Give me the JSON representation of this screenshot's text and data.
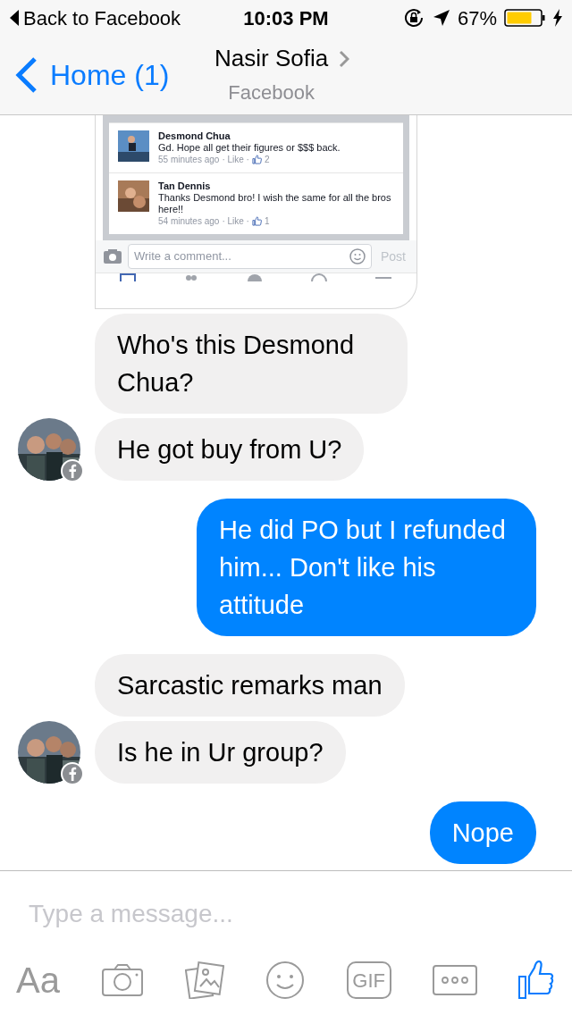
{
  "status_bar": {
    "back_label": "Back to Facebook",
    "time": "10:03 PM",
    "battery": "67%"
  },
  "nav": {
    "back": "Home (1)",
    "title": "Nasir Sofia",
    "subtitle": "Facebook"
  },
  "shared_image": {
    "comments": [
      {
        "name": "Desmond Chua",
        "text": "Gd. Hope all get their figures or $$$ back.",
        "time": "55 minutes ago",
        "like": "· Like ·",
        "likes": "2"
      },
      {
        "name": "Tan Dennis",
        "text": "Thanks Desmond bro! I wish the same for all the bros here!!",
        "time": "54 minutes ago",
        "like": "· Like ·",
        "likes": "1"
      }
    ],
    "comment_placeholder": "Write a comment...",
    "post": "Post"
  },
  "messages": [
    {
      "kind": "incoming",
      "text": "Who's this Desmond Chua?"
    },
    {
      "kind": "incoming",
      "text": "He got buy from U?"
    },
    {
      "kind": "outgoing",
      "text": "He did PO but I refunded him... Don't like his attitude"
    },
    {
      "kind": "incoming",
      "text": "Sarcastic remarks man"
    },
    {
      "kind": "incoming",
      "text": "Is he in Ur group?"
    },
    {
      "kind": "outgoing",
      "text": "Nope"
    }
  ],
  "composer": {
    "placeholder": "Type a message...",
    "font_label": "Aa",
    "gif_label": "GIF"
  }
}
